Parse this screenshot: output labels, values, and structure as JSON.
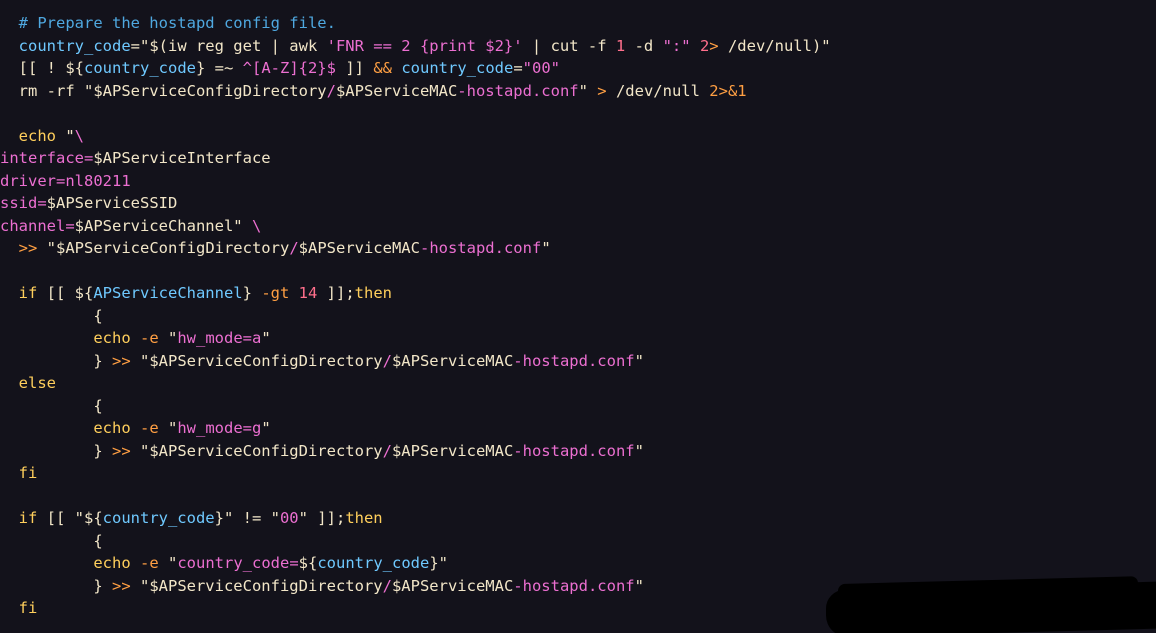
{
  "colors": {
    "background": "#13121b",
    "plain": "#f2e6c8",
    "keyword": "#ffcf5c",
    "variable": "#6fc9ff",
    "string": "#ec6fd1",
    "operator": "#ff9f43",
    "comment": "#4fa8e0",
    "number": "#ff6f8c"
  },
  "code_lines": [
    [
      [
        "comment",
        "  # Prepare the hostapd config file."
      ]
    ],
    [
      [
        "plain",
        "  "
      ],
      [
        "variable",
        "country_code"
      ],
      [
        "plain",
        "=\"$(iw reg get | awk "
      ],
      [
        "string",
        "'FNR == 2 {print $2}'"
      ],
      [
        "plain",
        " | cut -f "
      ],
      [
        "number",
        "1"
      ],
      [
        "plain",
        " -d "
      ],
      [
        "string",
        "\":\""
      ],
      [
        "plain",
        " "
      ],
      [
        "number",
        "2"
      ],
      [
        "operator",
        ">"
      ],
      [
        "plain",
        " /dev/null)\""
      ]
    ],
    [
      [
        "plain",
        "  [[ ! ${"
      ],
      [
        "variable",
        "country_code"
      ],
      [
        "plain",
        "} =~ "
      ],
      [
        "string",
        "^[A-Z]{2}$"
      ],
      [
        "plain",
        " ]] "
      ],
      [
        "operator",
        "&&"
      ],
      [
        "plain",
        " "
      ],
      [
        "variable",
        "country_code"
      ],
      [
        "plain",
        "="
      ],
      [
        "string",
        "\"00\""
      ]
    ],
    [
      [
        "plain",
        "  rm -rf \"$APServiceConfigDirectory"
      ],
      [
        "string",
        "/"
      ],
      [
        "plain",
        "$APServiceMAC"
      ],
      [
        "string",
        "-hostapd.conf"
      ],
      [
        "plain",
        "\" "
      ],
      [
        "operator",
        ">"
      ],
      [
        "plain",
        " /dev/null "
      ],
      [
        "operator",
        "2>&1"
      ]
    ],
    [
      [
        "plain",
        ""
      ]
    ],
    [
      [
        "keyword",
        "  echo"
      ],
      [
        "plain",
        " \""
      ],
      [
        "string",
        "\\"
      ]
    ],
    [
      [
        "string",
        "interface="
      ],
      [
        "plain",
        "$APServiceInterface"
      ]
    ],
    [
      [
        "string",
        "driver=nl80211"
      ]
    ],
    [
      [
        "string",
        "ssid="
      ],
      [
        "plain",
        "$APServiceSSID"
      ]
    ],
    [
      [
        "string",
        "channel="
      ],
      [
        "plain",
        "$APServiceChannel\" "
      ],
      [
        "string",
        "\\"
      ]
    ],
    [
      [
        "plain",
        "  "
      ],
      [
        "operator",
        ">>"
      ],
      [
        "plain",
        " \"$APServiceConfigDirectory"
      ],
      [
        "string",
        "/"
      ],
      [
        "plain",
        "$APServiceMAC"
      ],
      [
        "string",
        "-hostapd.conf"
      ],
      [
        "plain",
        "\""
      ]
    ],
    [
      [
        "plain",
        ""
      ]
    ],
    [
      [
        "keyword",
        "  if"
      ],
      [
        "plain",
        " [[ ${"
      ],
      [
        "variable",
        "APServiceChannel"
      ],
      [
        "plain",
        "} "
      ],
      [
        "operator",
        "-gt"
      ],
      [
        "plain",
        " "
      ],
      [
        "number",
        "14"
      ],
      [
        "plain",
        " ]];"
      ],
      [
        "keyword",
        "then"
      ]
    ],
    [
      [
        "plain",
        "          {"
      ]
    ],
    [
      [
        "keyword",
        "          echo"
      ],
      [
        "plain",
        " "
      ],
      [
        "operator",
        "-e"
      ],
      [
        "plain",
        " \""
      ],
      [
        "string",
        "hw_mode=a"
      ],
      [
        "plain",
        "\""
      ]
    ],
    [
      [
        "plain",
        "          } "
      ],
      [
        "operator",
        ">>"
      ],
      [
        "plain",
        " \"$APServiceConfigDirectory"
      ],
      [
        "string",
        "/"
      ],
      [
        "plain",
        "$APServiceMAC"
      ],
      [
        "string",
        "-hostapd.conf"
      ],
      [
        "plain",
        "\""
      ]
    ],
    [
      [
        "keyword",
        "  else"
      ]
    ],
    [
      [
        "plain",
        "          {"
      ]
    ],
    [
      [
        "keyword",
        "          echo"
      ],
      [
        "plain",
        " "
      ],
      [
        "operator",
        "-e"
      ],
      [
        "plain",
        " \""
      ],
      [
        "string",
        "hw_mode=g"
      ],
      [
        "plain",
        "\""
      ]
    ],
    [
      [
        "plain",
        "          } "
      ],
      [
        "operator",
        ">>"
      ],
      [
        "plain",
        " \"$APServiceConfigDirectory"
      ],
      [
        "string",
        "/"
      ],
      [
        "plain",
        "$APServiceMAC"
      ],
      [
        "string",
        "-hostapd.conf"
      ],
      [
        "plain",
        "\""
      ]
    ],
    [
      [
        "keyword",
        "  fi"
      ]
    ],
    [
      [
        "plain",
        ""
      ]
    ],
    [
      [
        "keyword",
        "  if"
      ],
      [
        "plain",
        " [[ \"${"
      ],
      [
        "variable",
        "country_code"
      ],
      [
        "plain",
        "}\" != \""
      ],
      [
        "string",
        "00"
      ],
      [
        "plain",
        "\" ]];"
      ],
      [
        "keyword",
        "then"
      ]
    ],
    [
      [
        "plain",
        "          {"
      ]
    ],
    [
      [
        "keyword",
        "          echo"
      ],
      [
        "plain",
        " "
      ],
      [
        "operator",
        "-e"
      ],
      [
        "plain",
        " \""
      ],
      [
        "string",
        "country_code="
      ],
      [
        "plain",
        "${"
      ],
      [
        "variable",
        "country_code"
      ],
      [
        "plain",
        "}\""
      ]
    ],
    [
      [
        "plain",
        "          } "
      ],
      [
        "operator",
        ">>"
      ],
      [
        "plain",
        " \"$APServiceConfigDirectory"
      ],
      [
        "string",
        "/"
      ],
      [
        "plain",
        "$APServiceMAC"
      ],
      [
        "string",
        "-hostapd.conf"
      ],
      [
        "plain",
        "\""
      ]
    ],
    [
      [
        "keyword",
        "  fi"
      ]
    ]
  ]
}
